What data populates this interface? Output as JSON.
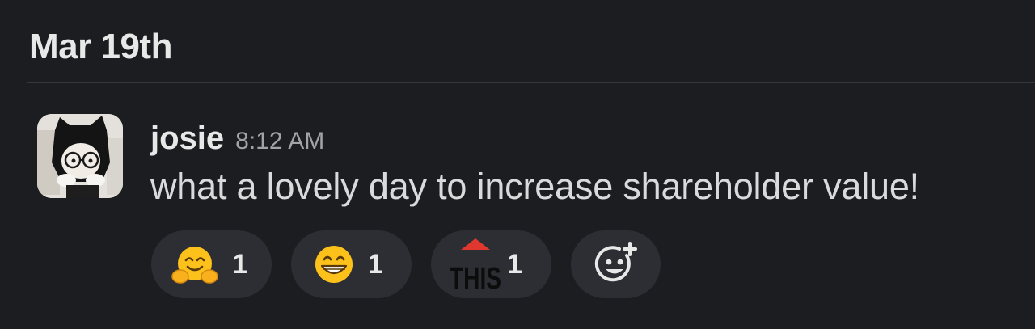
{
  "day_divider": {
    "date": "Mar 19th"
  },
  "message": {
    "author": "josie",
    "time": "8:12 AM",
    "text": "what a lovely day to increase shareholder value!",
    "avatar_icon": "user-avatar-photo"
  },
  "reactions": [
    {
      "emoji": "hugging-face-emoji",
      "count": "1"
    },
    {
      "emoji": "beaming-grin-emoji",
      "count": "1"
    },
    {
      "emoji": "this-arrow-emoji",
      "count": "1",
      "emoji_text": "THIS"
    }
  ],
  "add_reaction": {
    "icon": "add-reaction-icon"
  },
  "colors": {
    "background": "#1b1d21",
    "pill": "#2c2e33",
    "divider": "#35373b",
    "text_primary": "#e8e8e8",
    "text_secondary": "#a2a3a5",
    "emoji_yellow": "#fcc21b",
    "this_arrow_red": "#e0382f"
  }
}
